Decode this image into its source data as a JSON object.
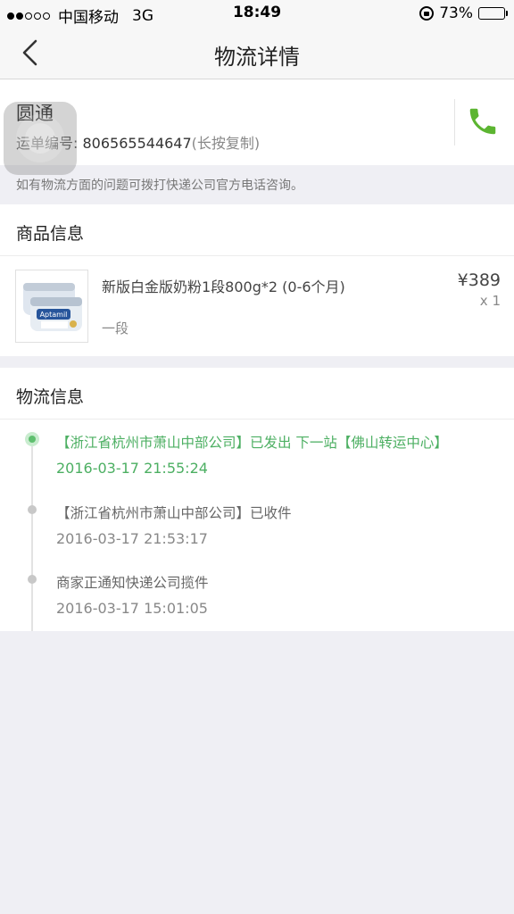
{
  "status_bar": {
    "carrier": "中国移动",
    "network": "3G",
    "time": "18:49",
    "battery": "73%"
  },
  "nav": {
    "title": "物流详情"
  },
  "shipment": {
    "carrier_name": "圆通",
    "waybill_label": "运单编号:",
    "waybill_number": "806565544647",
    "copy_hint": "(长按复制)",
    "notice": "如有物流方面的问题可拨打快递公司官方电话咨询。"
  },
  "goods": {
    "header": "商品信息",
    "items": [
      {
        "name": "新版白金版奶粉1段800g*2 (0-6个月)",
        "spec": "一段",
        "price": "¥389",
        "quantity": "x 1",
        "image_brand": "Aptamil"
      }
    ]
  },
  "logistics": {
    "header": "物流信息",
    "events": [
      {
        "description": "【浙江省杭州市萧山中部公司】已发出 下一站【佛山转运中心】",
        "time": "2016-03-17 21:55:24",
        "current": true
      },
      {
        "description": "【浙江省杭州市萧山中部公司】已收件",
        "time": "2016-03-17 21:53:17",
        "current": false
      },
      {
        "description": "商家正通知快递公司揽件",
        "time": "2016-03-17 15:01:05",
        "current": false
      }
    ]
  },
  "colors": {
    "accent_green": "#4caf62",
    "phone_green": "#5cb531",
    "background": "#efeff4"
  }
}
